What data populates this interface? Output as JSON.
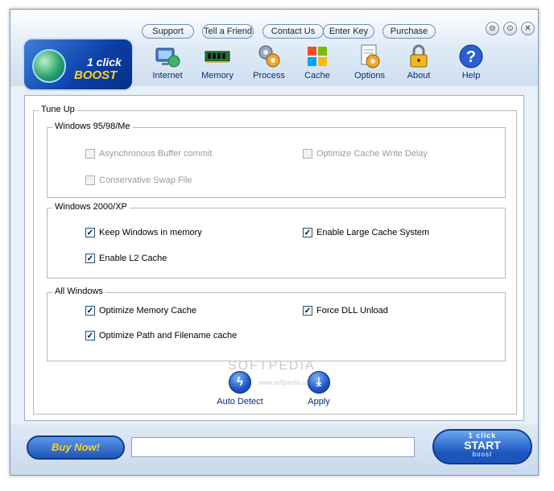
{
  "top_buttons": [
    "Support",
    "Tell a Friend",
    "Contact Us",
    "Enter Key",
    "Purchase"
  ],
  "window_controls": {
    "minimize": "⊖",
    "maximize": "⊙",
    "close": "✕"
  },
  "logo": {
    "line1": "1 click",
    "line2": "BOOST"
  },
  "nav": [
    {
      "label": "Internet",
      "icon": "internet-icon"
    },
    {
      "label": "Memory",
      "icon": "memory-icon"
    },
    {
      "label": "Process",
      "icon": "process-icon"
    },
    {
      "label": "Cache",
      "icon": "cache-icon"
    },
    {
      "label": "Options",
      "icon": "options-icon"
    },
    {
      "label": "About",
      "icon": "about-lock-icon"
    },
    {
      "label": "Help",
      "icon": "help-icon"
    }
  ],
  "tuneup": {
    "title": "Tune Up",
    "win9x": {
      "title": "Windows 95/98/Me",
      "options": [
        {
          "label": "Asynchronous Buffer commit",
          "checked": false,
          "enabled": false
        },
        {
          "label": "Optimize Cache Write Delay",
          "checked": false,
          "enabled": false
        },
        {
          "label": "Conservative Swap File",
          "checked": false,
          "enabled": false
        }
      ]
    },
    "win2k": {
      "title": "Windows 2000/XP",
      "options": [
        {
          "label": "Keep Windows in memory",
          "checked": true,
          "enabled": true
        },
        {
          "label": "Enable Large Cache System",
          "checked": true,
          "enabled": true
        },
        {
          "label": "Enable L2 Cache",
          "checked": true,
          "enabled": true
        }
      ]
    },
    "allwin": {
      "title": "All Windows",
      "options": [
        {
          "label": "Optimize Memory Cache",
          "checked": true,
          "enabled": true
        },
        {
          "label": "Force DLL Unload",
          "checked": true,
          "enabled": true
        },
        {
          "label": "Optimize Path and Filename cache",
          "checked": true,
          "enabled": true
        }
      ]
    }
  },
  "actions": {
    "auto_detect": "Auto Detect",
    "apply": "Apply"
  },
  "watermark": {
    "line1": "SOFTPEDIA",
    "line2": "www.softpedia.com"
  },
  "bottom": {
    "buy_now": "Buy Now!",
    "status": "",
    "start_top": "1 click",
    "start_main": "START",
    "start_bottom": "boost"
  },
  "colors": {
    "accent": "#1d55b8",
    "link_text": "#0b2d78",
    "brand_yellow": "#ffd21a"
  }
}
